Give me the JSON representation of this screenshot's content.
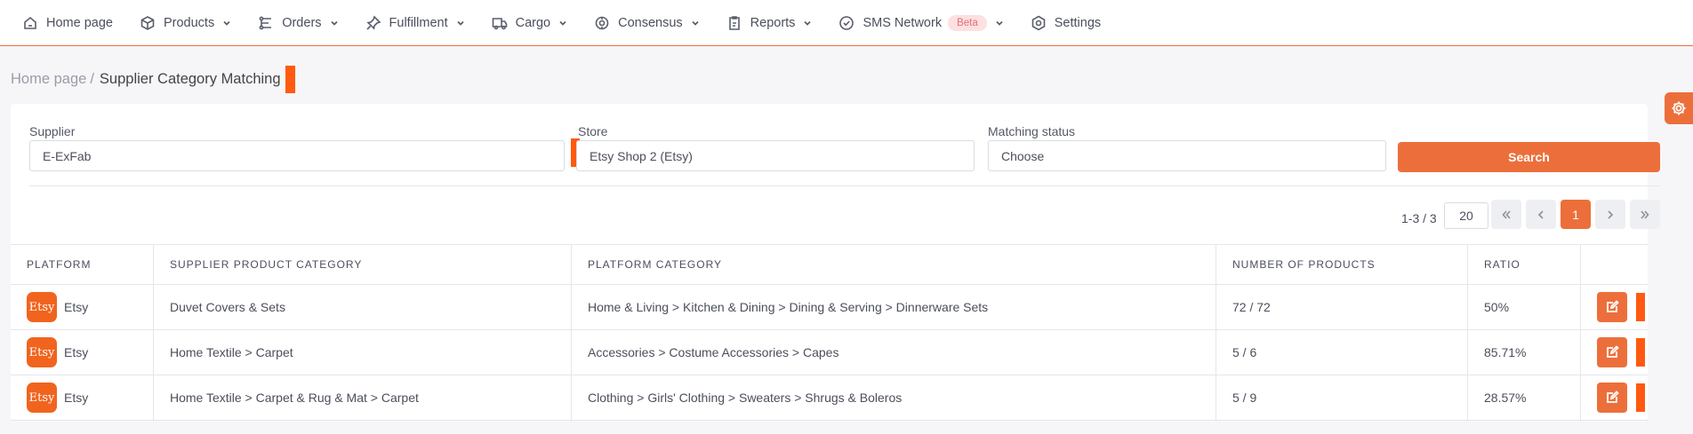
{
  "nav": [
    {
      "label": "Home page",
      "icon": "home-icon",
      "dropdown": false
    },
    {
      "label": "Products",
      "icon": "box-icon",
      "dropdown": true
    },
    {
      "label": "Orders",
      "icon": "orders-icon",
      "dropdown": true
    },
    {
      "label": "Fulfillment",
      "icon": "pin-icon",
      "dropdown": true
    },
    {
      "label": "Cargo",
      "icon": "truck-icon",
      "dropdown": true
    },
    {
      "label": "Consensus",
      "icon": "consensus-icon",
      "dropdown": true
    },
    {
      "label": "Reports",
      "icon": "report-icon",
      "dropdown": true
    },
    {
      "label": "SMS Network",
      "icon": "check-circle-icon",
      "dropdown": true,
      "badge": "Beta"
    },
    {
      "label": "Settings",
      "icon": "settings-icon",
      "dropdown": false
    }
  ],
  "breadcrumb": {
    "home": "Home page",
    "separator": "/",
    "current": "Supplier Category Matching"
  },
  "filters": {
    "supplier": {
      "label": "Supplier",
      "value": "E-ExFab"
    },
    "store": {
      "label": "Store",
      "value": "Etsy Shop 2 (Etsy)"
    },
    "status": {
      "label": "Matching status",
      "placeholder": "Choose"
    },
    "search_label": "Search"
  },
  "pagination": {
    "info": "1-3 / 3",
    "page_size": "20",
    "current_page": "1"
  },
  "table": {
    "headers": [
      "PLATFORM",
      "SUPPLIER PRODUCT CATEGORY",
      "PLATFORM CATEGORY",
      "NUMBER OF PRODUCTS",
      "RATIO"
    ],
    "rows": [
      {
        "platform_logo": "Etsy",
        "platform": "Etsy",
        "supplier_category": "Duvet Covers & Sets",
        "platform_category": "Home & Living > Kitchen & Dining > Dining & Serving > Dinnerware Sets",
        "products": "72 / 72",
        "ratio": "50%"
      },
      {
        "platform_logo": "Etsy",
        "platform": "Etsy",
        "supplier_category": "Home Textile > Carpet",
        "platform_category": "Accessories > Costume Accessories > Capes",
        "products": "5 / 6",
        "ratio": "85.71%"
      },
      {
        "platform_logo": "Etsy",
        "platform": "Etsy",
        "supplier_category": "Home Textile > Carpet & Rug & Mat > Carpet",
        "platform_category": "Clothing > Girls' Clothing > Sweaters > Shrugs & Boleros",
        "products": "5 / 9",
        "ratio": "28.57%"
      }
    ]
  },
  "colors": {
    "accent": "#ec6f3b",
    "marker": "#ff5a0f",
    "etsy": "#f1641e"
  }
}
